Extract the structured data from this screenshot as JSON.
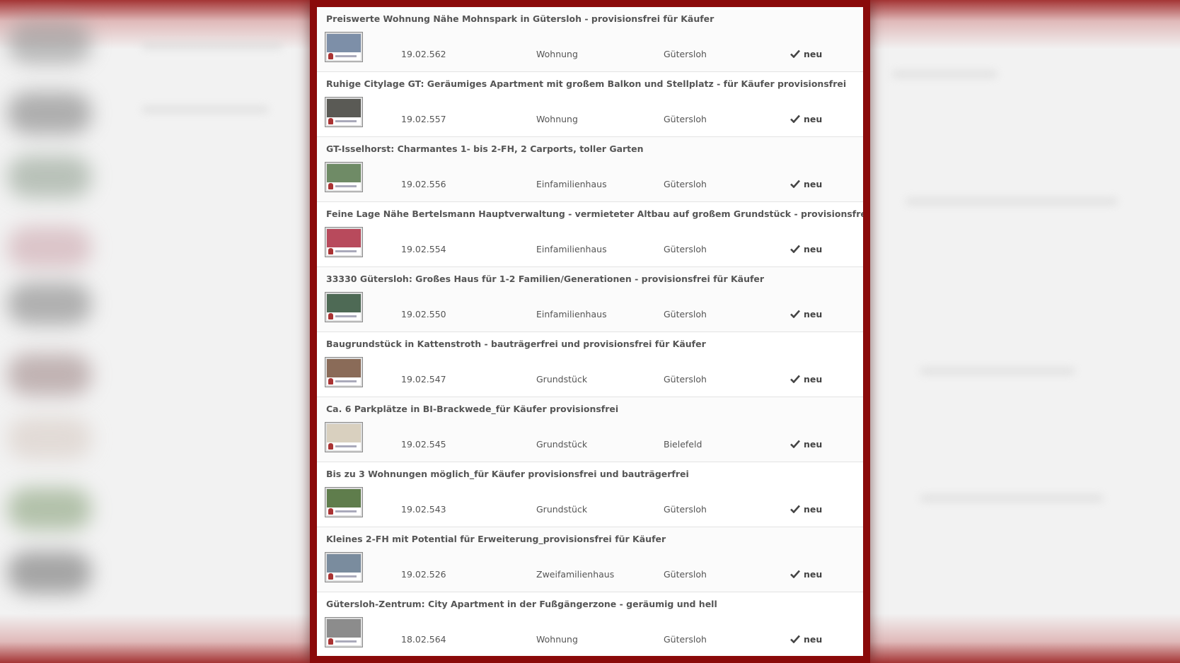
{
  "listings": [
    {
      "title": "Preiswerte Wohnung Nähe Mohnspark in Gütersloh - provisionsfrei für Käufer",
      "id": "19.02.562",
      "type": "Wohnung",
      "city": "Gütersloh",
      "status": "neu",
      "thumb_color": "#7d8fa8"
    },
    {
      "title": "Ruhige Citylage GT: Geräumiges Apartment mit großem Balkon und Stellplatz - für Käufer provisionsfrei",
      "id": "19.02.557",
      "type": "Wohnung",
      "city": "Gütersloh",
      "status": "neu",
      "thumb_color": "#5a5a55"
    },
    {
      "title": "GT-Isselhorst: Charmantes 1- bis 2-FH, 2 Carports, toller Garten",
      "id": "19.02.556",
      "type": "Einfamilienhaus",
      "city": "Gütersloh",
      "status": "neu",
      "thumb_color": "#6f8b66"
    },
    {
      "title": "Feine Lage Nähe Bertelsmann Hauptverwaltung - vermieteter Altbau auf großem Grundstück - provisionsfrei für Käufer",
      "id": "19.02.554",
      "type": "Einfamilienhaus",
      "city": "Gütersloh",
      "status": "neu",
      "thumb_color": "#b84a5c"
    },
    {
      "title": "33330 Gütersloh: Großes Haus für 1-2 Familien/Generationen - provisionsfrei für Käufer",
      "id": "19.02.550",
      "type": "Einfamilienhaus",
      "city": "Gütersloh",
      "status": "neu",
      "thumb_color": "#4e6a55"
    },
    {
      "title": "Baugrundstück in Kattenstroth - bauträgerfrei und provisionsfrei für Käufer",
      "id": "19.02.547",
      "type": "Grundstück",
      "city": "Gütersloh",
      "status": "neu",
      "thumb_color": "#8a6b58"
    },
    {
      "title": "Ca. 6 Parkplätze in BI-Brackwede_für Käufer provisionsfrei",
      "id": "19.02.545",
      "type": "Grundstück",
      "city": "Bielefeld",
      "status": "neu",
      "thumb_color": "#d9d0bf"
    },
    {
      "title": "Bis zu 3 Wohnungen möglich_für Käufer provisionsfrei und bauträgerfrei",
      "id": "19.02.543",
      "type": "Grundstück",
      "city": "Gütersloh",
      "status": "neu",
      "thumb_color": "#5f7d4c"
    },
    {
      "title": "Kleines 2-FH mit Potential für Erweiterung_provisionsfrei für Käufer",
      "id": "19.02.526",
      "type": "Zweifamilienhaus",
      "city": "Gütersloh",
      "status": "neu",
      "thumb_color": "#7a8c9e"
    },
    {
      "title": "Gütersloh-Zentrum: City Apartment in der Fußgängerzone - geräumig und hell",
      "id": "18.02.564",
      "type": "Wohnung",
      "city": "Gütersloh",
      "status": "neu",
      "thumb_color": "#8c8c8c"
    }
  ]
}
